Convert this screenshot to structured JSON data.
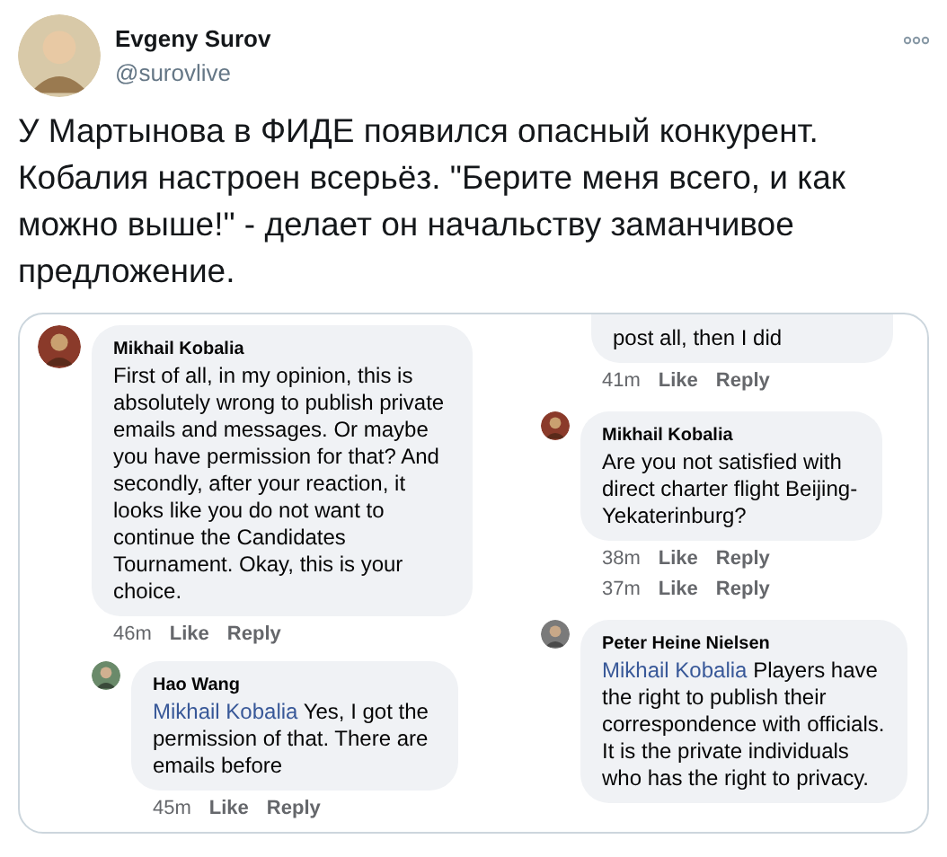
{
  "tweet": {
    "author": "Evgeny Surov",
    "handle": "@surovlive",
    "text": "У Мартынова в ФИДЕ появился опасный конкурент. Кобалия настроен всерьёз. \"Берите меня всего, и как можно выше!\" - делает он начальству заманчивое предложение."
  },
  "embedded": {
    "columns": [
      {
        "comments": [
          {
            "author": "Mikhail Kobalia",
            "text": "First of all, in my opinion, this is absolutely wrong to publish private emails and messages. Or maybe you have permission for that? And secondly, after your reaction, it looks like you do not want to continue the Candidates Tournament. Okay, this is your choice.",
            "meta": [
              {
                "time": "46m",
                "like": "Like",
                "reply": "Reply"
              }
            ],
            "children": [
              {
                "author": "Hao Wang",
                "mention": "Mikhail Kobalia",
                "text": "Yes, I got the permission of that. There are emails before",
                "meta": [
                  {
                    "time": "45m",
                    "like": "Like",
                    "reply": "Reply"
                  }
                ]
              }
            ]
          }
        ]
      },
      {
        "comments": [
          {
            "kind": "partial",
            "text": "post all, then I did",
            "meta": [
              {
                "time": "41m",
                "like": "Like",
                "reply": "Reply"
              }
            ]
          },
          {
            "author": "Mikhail Kobalia",
            "text": "Are you not satisfied with direct charter flight Beijing-Yekaterinburg?",
            "meta": [
              {
                "time": "38m",
                "like": "Like",
                "reply": "Reply"
              },
              {
                "time": "37m",
                "like": "Like",
                "reply": "Reply"
              }
            ]
          },
          {
            "author": "Peter Heine Nielsen",
            "mention": "Mikhail Kobalia",
            "text": "Players have the right to publish their correspondence with officials. It is the private individuals who has the right to privacy."
          }
        ]
      }
    ]
  }
}
